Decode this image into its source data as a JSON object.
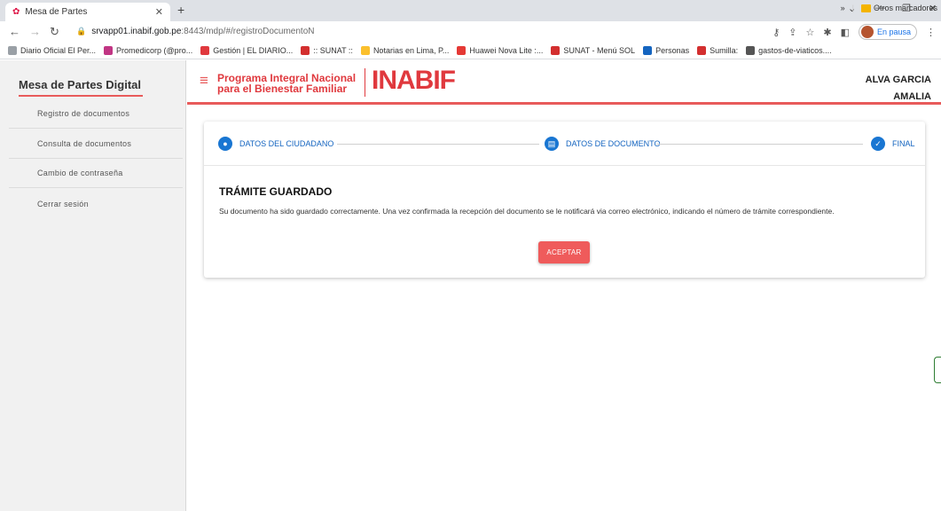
{
  "browser": {
    "tab_title": "Mesa de Partes",
    "url_host": "srvapp01.inabif.gob.pe",
    "url_path": ":8443/mdp/#/registroDocumentoN",
    "profile_status": "En pausa",
    "bookmarks": [
      {
        "label": "Diario Oficial El Per...",
        "color": "#9aa0a6"
      },
      {
        "label": "Promedicorp (@pro...",
        "color": "#c13584"
      },
      {
        "label": "Gestión | EL DIARIO...",
        "color": "#e0393e"
      },
      {
        "label": ":: SUNAT ::",
        "color": "#d32f2f"
      },
      {
        "label": "Notarias en Lima, P...",
        "color": "#fbc02d"
      },
      {
        "label": "Huawei Nova Lite :...",
        "color": "#e53935"
      },
      {
        "label": "SUNAT - Menú SOL",
        "color": "#d32f2f"
      },
      {
        "label": "Personas",
        "color": "#1565c0"
      },
      {
        "label": "Sumilla:",
        "color": "#d32f2f"
      },
      {
        "label": "gastos-de-viaticos....",
        "color": "#555555"
      }
    ],
    "other_bookmarks": "Otros marcadores"
  },
  "sidebar": {
    "title": "Mesa de Partes Digital",
    "items": [
      {
        "label": "Registro de documentos"
      },
      {
        "label": "Consulta de documentos"
      },
      {
        "label": "Cambio de contraseña"
      },
      {
        "label": "Cerrar sesión"
      }
    ]
  },
  "header": {
    "program_line1": "Programa Integral Nacional",
    "program_line2": "para el Bienestar Familiar",
    "logo_text": "INABIF",
    "user_line1": "ALVA GARCIA",
    "user_line2": "AMALIA"
  },
  "stepper": {
    "steps": [
      {
        "label": "DATOS DEL CIUDADANO",
        "icon": "person-icon"
      },
      {
        "label": "DATOS DE DOCUMENTO",
        "icon": "document-icon"
      },
      {
        "label": "FINAL",
        "icon": "check-icon"
      }
    ]
  },
  "result": {
    "title": "TRÁMITE GUARDADO",
    "message": "Su documento ha sido guardado correctamente. Una vez confirmada la recepción del documento se le notificará via correo electrónico, indicando el número de trámite correspondiente.",
    "accept_label": "ACEPTAR"
  },
  "colors": {
    "accent": "#e0393e",
    "step_blue": "#1976d2",
    "button": "#ef5b5b"
  }
}
